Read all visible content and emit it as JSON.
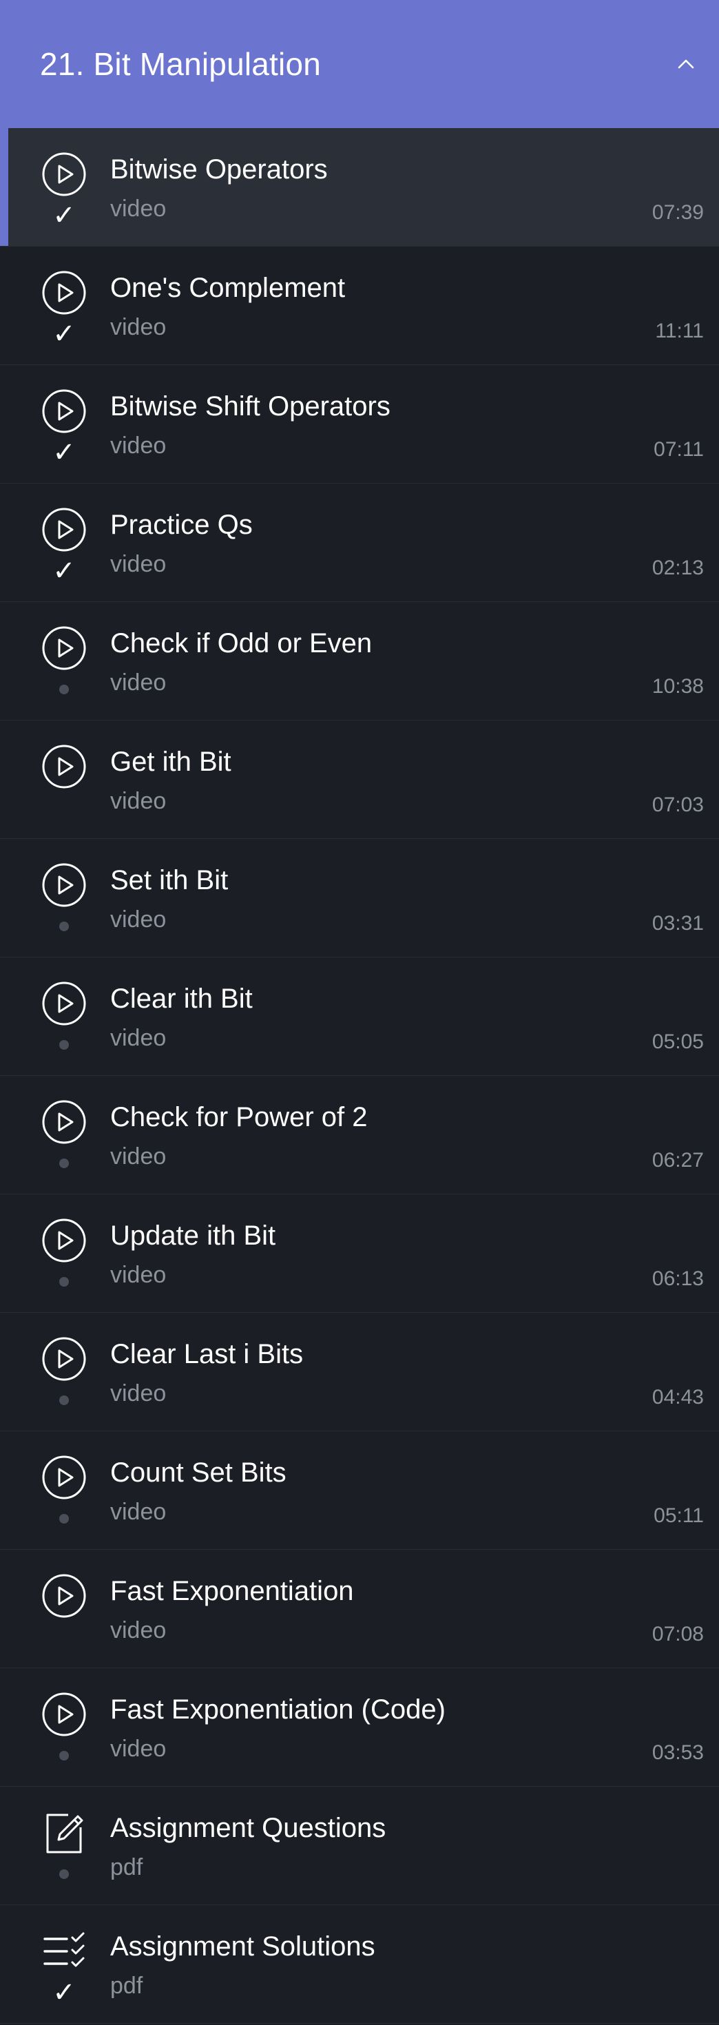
{
  "header": {
    "title": "21. Bit Manipulation",
    "collapse_icon": "chevron-up-icon"
  },
  "items": [
    {
      "title": "Bitwise Operators",
      "type": "video",
      "duration": "07:39",
      "icon": "play-icon",
      "status": "check",
      "active": true
    },
    {
      "title": "One's Complement",
      "type": "video",
      "duration": "11:11",
      "icon": "play-icon",
      "status": "check"
    },
    {
      "title": "Bitwise Shift Operators",
      "type": "video",
      "duration": "07:11",
      "icon": "play-icon",
      "status": "check"
    },
    {
      "title": "Practice Qs",
      "type": "video",
      "duration": "02:13",
      "icon": "play-icon",
      "status": "check"
    },
    {
      "title": "Check if Odd or Even",
      "type": "video",
      "duration": "10:38",
      "icon": "play-icon",
      "status": "dot"
    },
    {
      "title": "Get ith Bit",
      "type": "video",
      "duration": "07:03",
      "icon": "play-icon",
      "status": "none"
    },
    {
      "title": "Set ith Bit",
      "type": "video",
      "duration": "03:31",
      "icon": "play-icon",
      "status": "dot"
    },
    {
      "title": "Clear ith Bit",
      "type": "video",
      "duration": "05:05",
      "icon": "play-icon",
      "status": "dot"
    },
    {
      "title": "Check for Power of 2",
      "type": "video",
      "duration": "06:27",
      "icon": "play-icon",
      "status": "dot"
    },
    {
      "title": "Update ith Bit",
      "type": "video",
      "duration": "06:13",
      "icon": "play-icon",
      "status": "dot"
    },
    {
      "title": "Clear Last i Bits",
      "type": "video",
      "duration": "04:43",
      "icon": "play-icon",
      "status": "dot"
    },
    {
      "title": "Count Set Bits",
      "type": "video",
      "duration": "05:11",
      "icon": "play-icon",
      "status": "dot"
    },
    {
      "title": "Fast Exponentiation",
      "type": "video",
      "duration": "07:08",
      "icon": "play-icon",
      "status": "none"
    },
    {
      "title": "Fast Exponentiation (Code)",
      "type": "video",
      "duration": "03:53",
      "icon": "play-icon",
      "status": "dot"
    },
    {
      "title": "Assignment Questions",
      "type": "pdf",
      "duration": "",
      "icon": "edit-document-icon",
      "status": "dot"
    },
    {
      "title": "Assignment Solutions",
      "type": "pdf",
      "duration": "",
      "icon": "checklist-icon",
      "status": "check"
    }
  ],
  "colors": {
    "header_bg": "#6b75cf",
    "accent": "#6b75cf",
    "row_bg": "#1c1e25",
    "active_row_bg": "#2b2f38",
    "muted_text": "#8d929c"
  }
}
